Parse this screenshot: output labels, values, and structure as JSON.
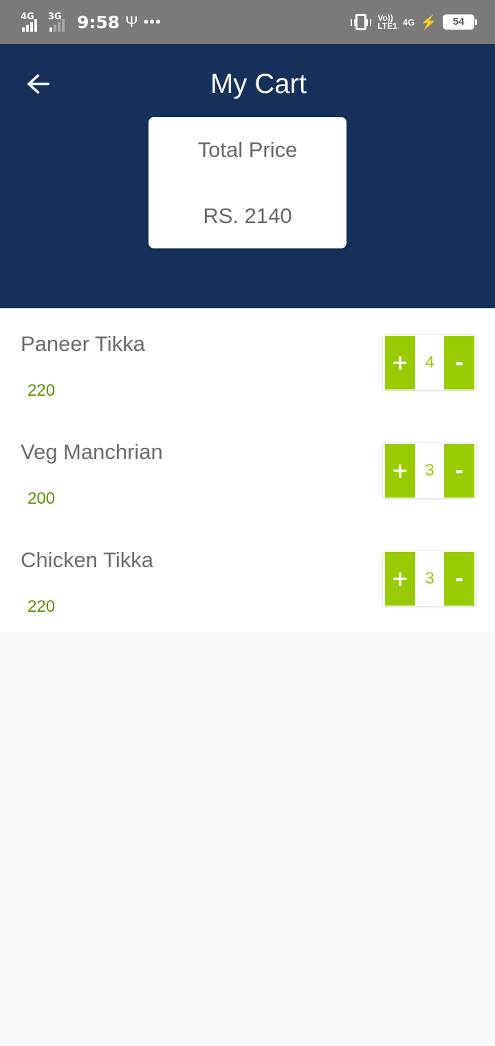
{
  "status_bar": {
    "network_1": "4G",
    "network_2": "3G",
    "time": "9:58",
    "usb_glyph": "Ψ",
    "more_glyph": "•••",
    "volte_line1": "Vo))",
    "volte_line2": "LTE1",
    "data_type": "4G",
    "charging_glyph": "⚡",
    "battery": "54"
  },
  "header": {
    "title": "My Cart",
    "back_icon": "arrow-back",
    "background_color": "#15315b"
  },
  "summary": {
    "label": "Total Price",
    "value": "RS. 2140"
  },
  "cart": {
    "plus_label": "+",
    "minus_label": "-",
    "accent_color": "#99cc00",
    "items": [
      {
        "name": "Paneer Tikka",
        "price": "220",
        "quantity": "4"
      },
      {
        "name": "Veg Manchrian",
        "price": "200",
        "quantity": "3"
      },
      {
        "name": "Chicken Tikka",
        "price": "220",
        "quantity": "3"
      }
    ]
  }
}
